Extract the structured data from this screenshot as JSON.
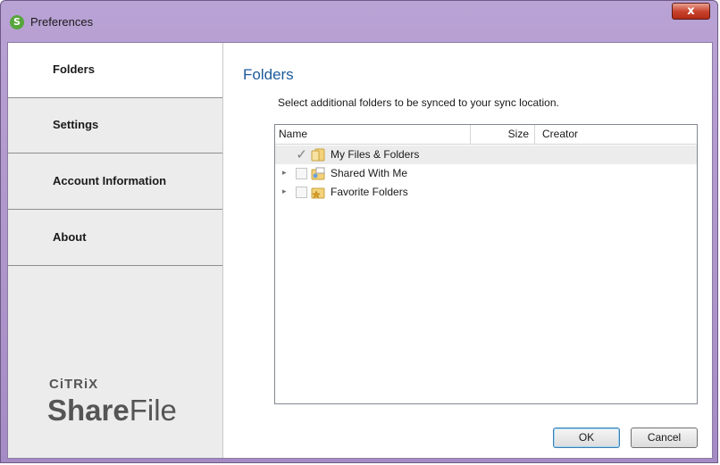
{
  "window": {
    "title": "Preferences",
    "icon": "sharefile-s-icon",
    "close_label": "x"
  },
  "sidebar": {
    "items": [
      {
        "label": "Folders",
        "active": true
      },
      {
        "label": "Settings",
        "active": false
      },
      {
        "label": "Account Information",
        "active": false
      },
      {
        "label": "About",
        "active": false
      }
    ],
    "logo": {
      "citrix": "CiTRiX",
      "share": "Share",
      "file": "File"
    }
  },
  "main": {
    "title": "Folders",
    "instructions": "Select additional folders to be synced to your sync location.",
    "columns": {
      "name": "Name",
      "size": "Size",
      "creator": "Creator"
    },
    "rows": [
      {
        "label": "My Files & Folders",
        "checked": true,
        "expandable": false,
        "icon": "folder-icon"
      },
      {
        "label": "Shared With Me",
        "checked": false,
        "expandable": true,
        "icon": "shared-folder-icon"
      },
      {
        "label": "Favorite Folders",
        "checked": false,
        "expandable": true,
        "icon": "favorite-folder-icon"
      }
    ]
  },
  "buttons": {
    "ok": "OK",
    "cancel": "Cancel"
  },
  "colors": {
    "title_blue": "#1d5a9c",
    "titlebar": "#a58bc5",
    "close_red": "#c9452f"
  }
}
